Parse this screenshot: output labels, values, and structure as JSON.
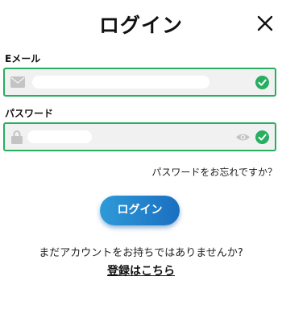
{
  "header": {
    "title": "ログイン",
    "close_icon": "close-icon"
  },
  "email": {
    "label": "Eメール",
    "icon": "mail-icon",
    "status_icon": "check-circle-icon"
  },
  "password": {
    "label": "パスワード",
    "icon": "lock-icon",
    "toggle_icon": "eye-icon",
    "status_icon": "check-circle-icon"
  },
  "forgot_password": "パスワードをお忘れですか？",
  "login_button": "ログイン",
  "footer": {
    "no_account": "まだアカウントをお持ちではありませんか?",
    "register_link": "登録はこちら"
  },
  "colors": {
    "valid_border": "#27ae60",
    "button_start": "#2f9ad8",
    "button_end": "#1a6fc0"
  }
}
